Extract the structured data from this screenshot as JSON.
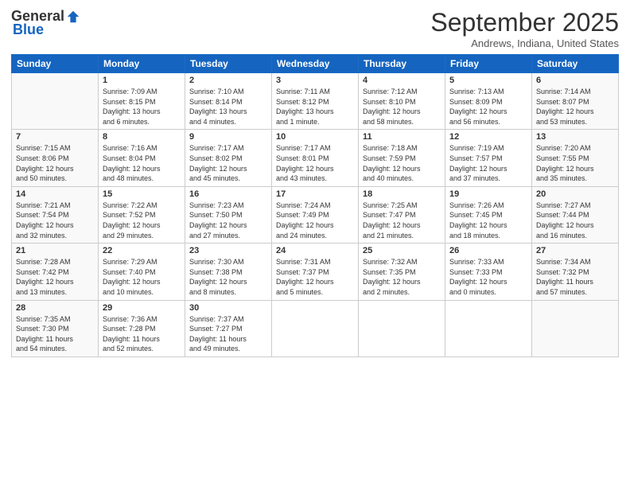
{
  "header": {
    "logo_general": "General",
    "logo_blue": "Blue",
    "month": "September 2025",
    "location": "Andrews, Indiana, United States"
  },
  "weekdays": [
    "Sunday",
    "Monday",
    "Tuesday",
    "Wednesday",
    "Thursday",
    "Friday",
    "Saturday"
  ],
  "weeks": [
    [
      {
        "day": "",
        "info": ""
      },
      {
        "day": "1",
        "info": "Sunrise: 7:09 AM\nSunset: 8:15 PM\nDaylight: 13 hours\nand 6 minutes."
      },
      {
        "day": "2",
        "info": "Sunrise: 7:10 AM\nSunset: 8:14 PM\nDaylight: 13 hours\nand 4 minutes."
      },
      {
        "day": "3",
        "info": "Sunrise: 7:11 AM\nSunset: 8:12 PM\nDaylight: 13 hours\nand 1 minute."
      },
      {
        "day": "4",
        "info": "Sunrise: 7:12 AM\nSunset: 8:10 PM\nDaylight: 12 hours\nand 58 minutes."
      },
      {
        "day": "5",
        "info": "Sunrise: 7:13 AM\nSunset: 8:09 PM\nDaylight: 12 hours\nand 56 minutes."
      },
      {
        "day": "6",
        "info": "Sunrise: 7:14 AM\nSunset: 8:07 PM\nDaylight: 12 hours\nand 53 minutes."
      }
    ],
    [
      {
        "day": "7",
        "info": "Sunrise: 7:15 AM\nSunset: 8:06 PM\nDaylight: 12 hours\nand 50 minutes."
      },
      {
        "day": "8",
        "info": "Sunrise: 7:16 AM\nSunset: 8:04 PM\nDaylight: 12 hours\nand 48 minutes."
      },
      {
        "day": "9",
        "info": "Sunrise: 7:17 AM\nSunset: 8:02 PM\nDaylight: 12 hours\nand 45 minutes."
      },
      {
        "day": "10",
        "info": "Sunrise: 7:17 AM\nSunset: 8:01 PM\nDaylight: 12 hours\nand 43 minutes."
      },
      {
        "day": "11",
        "info": "Sunrise: 7:18 AM\nSunset: 7:59 PM\nDaylight: 12 hours\nand 40 minutes."
      },
      {
        "day": "12",
        "info": "Sunrise: 7:19 AM\nSunset: 7:57 PM\nDaylight: 12 hours\nand 37 minutes."
      },
      {
        "day": "13",
        "info": "Sunrise: 7:20 AM\nSunset: 7:55 PM\nDaylight: 12 hours\nand 35 minutes."
      }
    ],
    [
      {
        "day": "14",
        "info": "Sunrise: 7:21 AM\nSunset: 7:54 PM\nDaylight: 12 hours\nand 32 minutes."
      },
      {
        "day": "15",
        "info": "Sunrise: 7:22 AM\nSunset: 7:52 PM\nDaylight: 12 hours\nand 29 minutes."
      },
      {
        "day": "16",
        "info": "Sunrise: 7:23 AM\nSunset: 7:50 PM\nDaylight: 12 hours\nand 27 minutes."
      },
      {
        "day": "17",
        "info": "Sunrise: 7:24 AM\nSunset: 7:49 PM\nDaylight: 12 hours\nand 24 minutes."
      },
      {
        "day": "18",
        "info": "Sunrise: 7:25 AM\nSunset: 7:47 PM\nDaylight: 12 hours\nand 21 minutes."
      },
      {
        "day": "19",
        "info": "Sunrise: 7:26 AM\nSunset: 7:45 PM\nDaylight: 12 hours\nand 18 minutes."
      },
      {
        "day": "20",
        "info": "Sunrise: 7:27 AM\nSunset: 7:44 PM\nDaylight: 12 hours\nand 16 minutes."
      }
    ],
    [
      {
        "day": "21",
        "info": "Sunrise: 7:28 AM\nSunset: 7:42 PM\nDaylight: 12 hours\nand 13 minutes."
      },
      {
        "day": "22",
        "info": "Sunrise: 7:29 AM\nSunset: 7:40 PM\nDaylight: 12 hours\nand 10 minutes."
      },
      {
        "day": "23",
        "info": "Sunrise: 7:30 AM\nSunset: 7:38 PM\nDaylight: 12 hours\nand 8 minutes."
      },
      {
        "day": "24",
        "info": "Sunrise: 7:31 AM\nSunset: 7:37 PM\nDaylight: 12 hours\nand 5 minutes."
      },
      {
        "day": "25",
        "info": "Sunrise: 7:32 AM\nSunset: 7:35 PM\nDaylight: 12 hours\nand 2 minutes."
      },
      {
        "day": "26",
        "info": "Sunrise: 7:33 AM\nSunset: 7:33 PM\nDaylight: 12 hours\nand 0 minutes."
      },
      {
        "day": "27",
        "info": "Sunrise: 7:34 AM\nSunset: 7:32 PM\nDaylight: 11 hours\nand 57 minutes."
      }
    ],
    [
      {
        "day": "28",
        "info": "Sunrise: 7:35 AM\nSunset: 7:30 PM\nDaylight: 11 hours\nand 54 minutes."
      },
      {
        "day": "29",
        "info": "Sunrise: 7:36 AM\nSunset: 7:28 PM\nDaylight: 11 hours\nand 52 minutes."
      },
      {
        "day": "30",
        "info": "Sunrise: 7:37 AM\nSunset: 7:27 PM\nDaylight: 11 hours\nand 49 minutes."
      },
      {
        "day": "",
        "info": ""
      },
      {
        "day": "",
        "info": ""
      },
      {
        "day": "",
        "info": ""
      },
      {
        "day": "",
        "info": ""
      }
    ]
  ]
}
